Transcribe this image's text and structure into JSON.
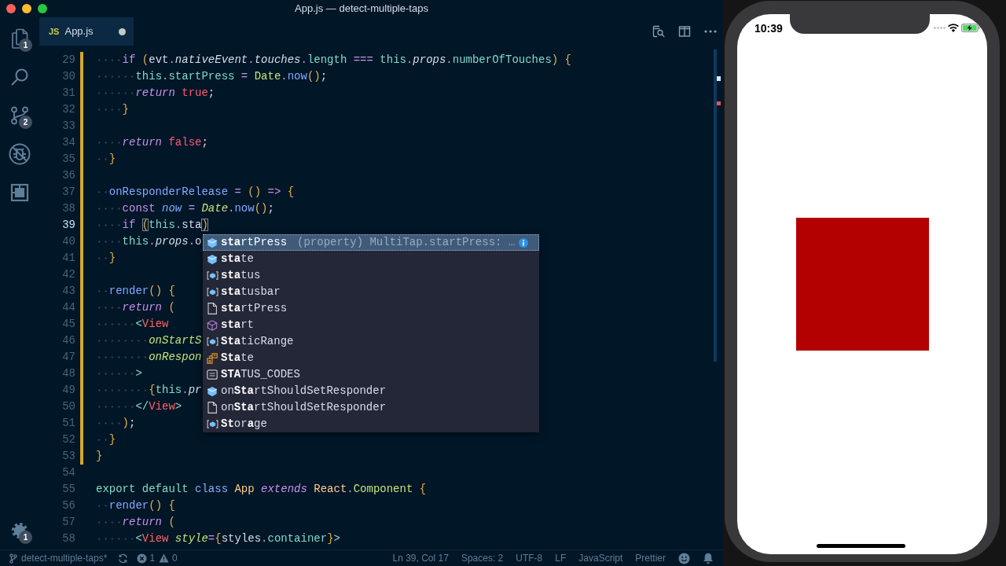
{
  "window": {
    "title": "App.js — detect-multiple-taps"
  },
  "activity_bar": {
    "items": [
      {
        "kind": "files",
        "badge": "1"
      },
      {
        "kind": "search"
      },
      {
        "kind": "scm",
        "badge": "2"
      },
      {
        "kind": "debug"
      },
      {
        "kind": "extensions"
      }
    ],
    "manage": {
      "badge": "1"
    }
  },
  "tabs": [
    {
      "file_type": "JS",
      "label": "App.js",
      "selected": true,
      "unsaved": true
    }
  ],
  "editor": {
    "lines": [
      {
        "number": "29",
        "current": false,
        "modified": true,
        "tokens": [
          {
            "kind": "keyword",
            "text": "    if "
          },
          {
            "kind": "bracket",
            "text": "("
          },
          {
            "kind": "variable",
            "text": "evt"
          },
          {
            "kind": "operator",
            "text": "."
          },
          {
            "kind": "field",
            "text": "nativeEvent"
          },
          {
            "kind": "operator",
            "text": "."
          },
          {
            "kind": "field",
            "text": "touches"
          },
          {
            "kind": "operator",
            "text": "."
          },
          {
            "kind": "member",
            "text": "length "
          },
          {
            "kind": "operator",
            "text": "=== "
          },
          {
            "kind": "member",
            "text": "this"
          },
          {
            "kind": "operator",
            "text": "."
          },
          {
            "kind": "field",
            "text": "props"
          },
          {
            "kind": "operator",
            "text": "."
          },
          {
            "kind": "member",
            "text": "numberOfTouches"
          },
          {
            "kind": "bracket",
            "text": ") {"
          }
        ]
      },
      {
        "number": "30",
        "current": false,
        "modified": true,
        "tokens": [
          {
            "kind": "member",
            "text": "      this"
          },
          {
            "kind": "operator",
            "text": "."
          },
          {
            "kind": "member",
            "text": "startPress "
          },
          {
            "kind": "operator",
            "text": "= "
          },
          {
            "kind": "support",
            "text": "Date"
          },
          {
            "kind": "operator",
            "text": "."
          },
          {
            "kind": "function",
            "text": "now"
          },
          {
            "kind": "bracket",
            "text": "()"
          },
          {
            "kind": "punctuation",
            "text": ";"
          }
        ]
      },
      {
        "number": "31",
        "current": false,
        "modified": true,
        "tokens": [
          {
            "kind": "flow",
            "text": "      return "
          },
          {
            "kind": "boolean",
            "text": "true"
          },
          {
            "kind": "punctuation",
            "text": ";"
          }
        ]
      },
      {
        "number": "32",
        "current": false,
        "modified": true,
        "tokens": [
          {
            "kind": "bracket",
            "text": "    }"
          }
        ]
      },
      {
        "number": "33",
        "current": false,
        "modified": true
      },
      {
        "number": "34",
        "current": false,
        "modified": true,
        "tokens": [
          {
            "kind": "flow",
            "text": "    return "
          },
          {
            "kind": "boolean",
            "text": "false"
          },
          {
            "kind": "punctuation",
            "text": ";"
          }
        ]
      },
      {
        "number": "35",
        "current": false,
        "modified": true,
        "tokens": [
          {
            "kind": "bracket",
            "text": "  }"
          }
        ]
      },
      {
        "number": "36",
        "current": false,
        "modified": true
      },
      {
        "number": "37",
        "current": false,
        "modified": true,
        "tokens": [
          {
            "kind": "function",
            "text": "  onResponderRelease "
          },
          {
            "kind": "operator",
            "text": "= "
          },
          {
            "kind": "bracket",
            "text": "() "
          },
          {
            "kind": "operator",
            "text": "=> "
          },
          {
            "kind": "bracket",
            "text": "{"
          }
        ]
      },
      {
        "number": "38",
        "current": false,
        "modified": true,
        "tokens": [
          {
            "kind": "keyword",
            "text": "    const "
          },
          {
            "kind": "local",
            "text": "now "
          },
          {
            "kind": "operator",
            "text": "= "
          },
          {
            "kind": "global",
            "text": "Date"
          },
          {
            "kind": "operator",
            "text": "."
          },
          {
            "kind": "function",
            "text": "now"
          },
          {
            "kind": "bracket",
            "text": "()"
          },
          {
            "kind": "punctuation",
            "text": ";"
          }
        ]
      },
      {
        "number": "39",
        "current": true,
        "modified": true,
        "tokens": [
          {
            "kind": "keyword",
            "text": "    if "
          },
          {
            "kind": "match",
            "text": "("
          },
          {
            "kind": "member",
            "text": "this"
          },
          {
            "kind": "operator",
            "text": "."
          },
          {
            "kind": "variable",
            "text": "sta"
          },
          {
            "kind": "match",
            "text": ")"
          }
        ]
      },
      {
        "number": "40",
        "current": false,
        "modified": true,
        "tokens": [
          {
            "kind": "member",
            "text": "    this"
          },
          {
            "kind": "operator",
            "text": "."
          },
          {
            "kind": "field",
            "text": "props"
          },
          {
            "kind": "operator",
            "text": "."
          },
          {
            "kind": "variable",
            "text": "o"
          }
        ]
      },
      {
        "number": "41",
        "current": false,
        "modified": true,
        "tokens": [
          {
            "kind": "bracket",
            "text": "  }"
          }
        ]
      },
      {
        "number": "42",
        "current": false,
        "modified": true
      },
      {
        "number": "43",
        "current": false,
        "modified": true,
        "tokens": [
          {
            "kind": "function",
            "text": "  render"
          },
          {
            "kind": "bracket",
            "text": "() {"
          }
        ]
      },
      {
        "number": "44",
        "current": false,
        "modified": true,
        "tokens": [
          {
            "kind": "flow",
            "text": "    return "
          },
          {
            "kind": "bracket",
            "text": "("
          }
        ]
      },
      {
        "number": "45",
        "current": false,
        "modified": true,
        "tokens": [
          {
            "kind": "member",
            "text": "      <"
          },
          {
            "kind": "tag",
            "text": "View"
          }
        ]
      },
      {
        "number": "46",
        "current": false,
        "modified": true,
        "tokens": [
          {
            "kind": "attribute",
            "text": "        onStartS"
          }
        ]
      },
      {
        "number": "47",
        "current": false,
        "modified": true,
        "tokens": [
          {
            "kind": "attribute",
            "text": "        onRespon"
          }
        ]
      },
      {
        "number": "48",
        "current": false,
        "modified": true,
        "tokens": [
          {
            "kind": "member",
            "text": "      >"
          }
        ]
      },
      {
        "number": "49",
        "current": false,
        "modified": true,
        "tokens": [
          {
            "kind": "bracket",
            "text": "        {"
          },
          {
            "kind": "member",
            "text": "this"
          },
          {
            "kind": "operator",
            "text": "."
          },
          {
            "kind": "field",
            "text": "pr"
          }
        ]
      },
      {
        "number": "50",
        "current": false,
        "modified": true,
        "tokens": [
          {
            "kind": "member",
            "text": "      </"
          },
          {
            "kind": "tag",
            "text": "View"
          },
          {
            "kind": "member",
            "text": ">"
          }
        ]
      },
      {
        "number": "51",
        "current": false,
        "modified": true,
        "tokens": [
          {
            "kind": "bracket",
            "text": "    )"
          },
          {
            "kind": "punctuation",
            "text": ";"
          }
        ]
      },
      {
        "number": "52",
        "current": false,
        "modified": true,
        "tokens": [
          {
            "kind": "bracket",
            "text": "  }"
          }
        ]
      },
      {
        "number": "53",
        "current": false,
        "modified": true,
        "tokens": [
          {
            "kind": "bracket",
            "text": "}"
          }
        ]
      },
      {
        "number": "54",
        "current": false,
        "modified": false
      },
      {
        "number": "55",
        "current": false,
        "modified": false,
        "tokens": [
          {
            "kind": "member",
            "text": "export default "
          },
          {
            "kind": "storage",
            "text": "class "
          },
          {
            "kind": "classname",
            "text": "App "
          },
          {
            "kind": "flow",
            "text": "extends "
          },
          {
            "kind": "classname",
            "text": "React"
          },
          {
            "kind": "operator",
            "text": "."
          },
          {
            "kind": "support",
            "text": "Component "
          },
          {
            "kind": "bracket",
            "text": "{"
          }
        ]
      },
      {
        "number": "56",
        "current": false,
        "modified": false,
        "tokens": [
          {
            "kind": "function",
            "text": "  render"
          },
          {
            "kind": "bracket",
            "text": "() {"
          }
        ]
      },
      {
        "number": "57",
        "current": false,
        "modified": false,
        "tokens": [
          {
            "kind": "flow",
            "text": "    return "
          },
          {
            "kind": "bracket",
            "text": "("
          }
        ]
      },
      {
        "number": "58",
        "current": false,
        "modified": false,
        "tokens": [
          {
            "kind": "member",
            "text": "      <"
          },
          {
            "kind": "tag",
            "text": "View "
          },
          {
            "kind": "attribute",
            "text": "style"
          },
          {
            "kind": "operator",
            "text": "="
          },
          {
            "kind": "bracket",
            "text": "{"
          },
          {
            "kind": "variable",
            "text": "styles"
          },
          {
            "kind": "operator",
            "text": "."
          },
          {
            "kind": "member",
            "text": "container"
          },
          {
            "kind": "bracket",
            "text": "}"
          },
          {
            "kind": "member",
            "text": ">"
          }
        ]
      }
    ],
    "suggestions": [
      {
        "kind": "property",
        "label": "**sta**rtPress",
        "detail": "(property) MultiTap.startPress: …",
        "selected": true
      },
      {
        "kind": "property",
        "label": "**sta**te",
        "selected": false
      },
      {
        "kind": "variable",
        "label": "**sta**tus",
        "selected": false
      },
      {
        "kind": "variable",
        "label": "**sta**tusbar",
        "selected": false
      },
      {
        "kind": "text",
        "label": "**sta**rtPress",
        "selected": false
      },
      {
        "kind": "module",
        "label": "**sta**rt",
        "selected": false
      },
      {
        "kind": "variable",
        "label": "**Sta**ticRange",
        "selected": false
      },
      {
        "kind": "class",
        "label": "**Sta**te",
        "selected": false
      },
      {
        "kind": "enum",
        "label": "**STA**TUS_CODES",
        "selected": false
      },
      {
        "kind": "property",
        "label": "on**Sta**rtShouldSetResponder",
        "selected": false
      },
      {
        "kind": "text",
        "label": "on**Sta**rtShouldSetResponder",
        "selected": false
      },
      {
        "kind": "variable",
        "label": "**St**or**a**ge",
        "selected": false
      }
    ]
  },
  "status_bar": {
    "branch": "detect-multiple-taps*",
    "errors": "1",
    "warnings": "0",
    "items": [
      "Ln 39, Col 17",
      "Spaces: 2",
      "UTF-8",
      "LF",
      "JavaScript",
      "Prettier"
    ]
  },
  "simulator": {
    "time": "10:39"
  }
}
